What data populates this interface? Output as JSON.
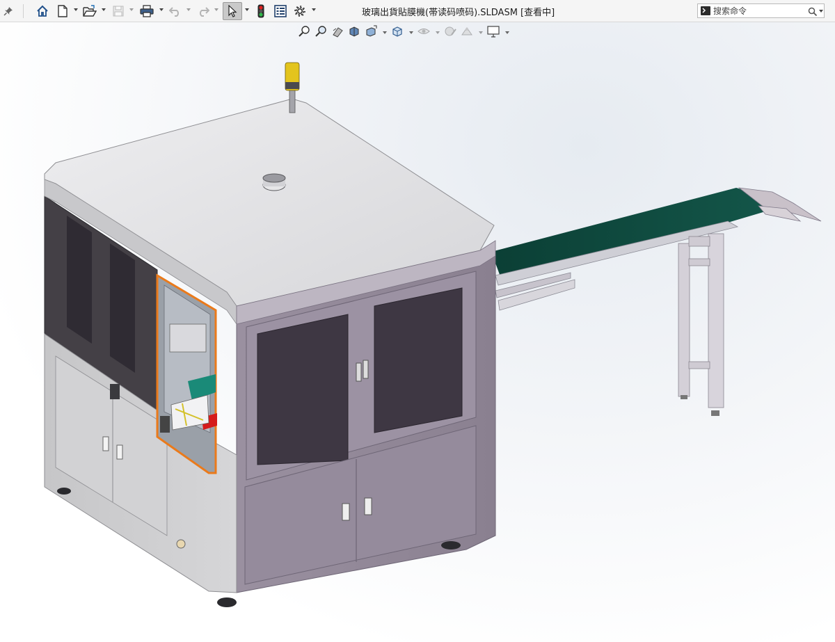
{
  "window": {
    "title": "玻璃出貨貼膜機(帯读码喷码).SLDASM [查看中]"
  },
  "toolbar": {
    "icons": [
      "pin-icon",
      "home-icon",
      "new-document-icon",
      "open-folder-icon",
      "save-icon",
      "print-icon",
      "undo-icon",
      "redo-icon",
      "select-arrow-icon",
      "rebuild-traffic-light-icon",
      "file-properties-icon",
      "options-gear-icon"
    ]
  },
  "search": {
    "placeholder": "搜索命令"
  },
  "view_toolbar": {
    "icons": [
      "zoom-to-fit-icon",
      "zoom-to-area-icon",
      "previous-view-icon",
      "section-view-icon",
      "view-orientation-icon",
      "display-style-icon",
      "hide-show-items-icon",
      "edit-appearance-icon",
      "apply-scene-icon",
      "view-settings-icon"
    ]
  },
  "colors": {
    "machine_top": "#e4e4e6",
    "machine_side_purple": "#8e8495",
    "window_dark": "#3e3743",
    "left_frame": "#c9c9cb",
    "conveyor_belt": "#0e4a3e",
    "orange_frame": "#ea7a1b",
    "signal_light": "#e3c41d"
  }
}
